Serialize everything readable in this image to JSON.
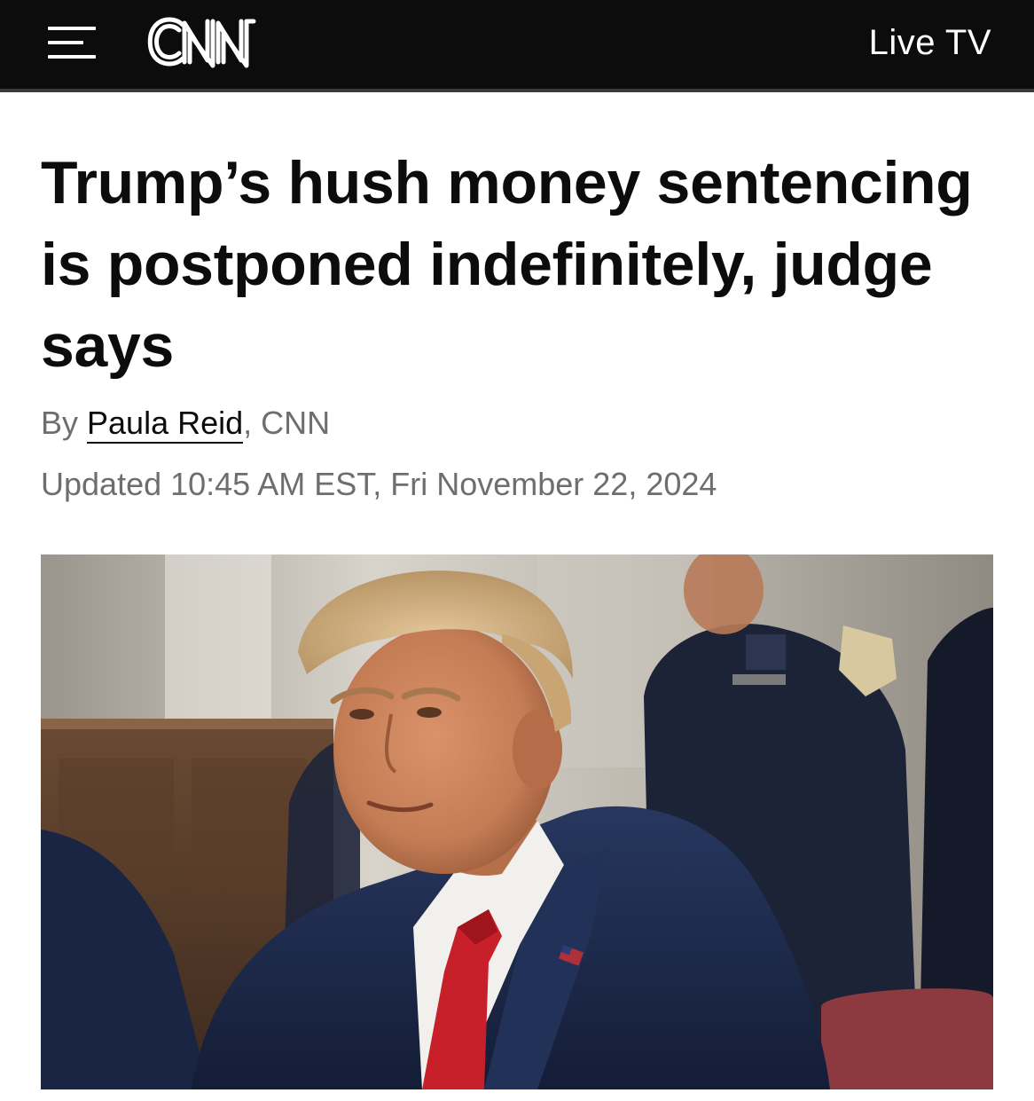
{
  "header": {
    "menu_icon": "hamburger-menu-icon",
    "logo_text": "CNN",
    "live_tv_label": "Live TV"
  },
  "article": {
    "headline": "Trump’s hush money sentencing is postponed indefinitely, judge says",
    "byline_prefix": "By ",
    "author": "Paula Reid",
    "byline_suffix": ", CNN",
    "updated": "Updated 10:45 AM EST, Fri November 22, 2024"
  },
  "colors": {
    "header_bg": "#0c0c0c",
    "text_primary": "#0c0c0c",
    "text_secondary": "#6e6e6e",
    "suit": "#1f2d52",
    "tie": "#c8202a"
  }
}
